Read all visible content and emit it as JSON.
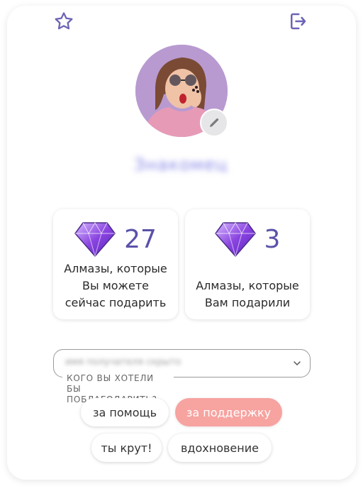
{
  "header": {
    "favorite_icon": "star-icon",
    "logout_icon": "logout-icon"
  },
  "profile": {
    "username": "Знакомец",
    "edit_icon": "pencil-icon"
  },
  "stats": [
    {
      "value": "27",
      "label_lines": [
        "Алмазы, которые",
        "Вы можете",
        "сейчас подарить"
      ],
      "icon": "diamond-icon"
    },
    {
      "value": "3",
      "label_lines": [
        "Алмазы, которые",
        "Вам подарили"
      ],
      "icon": "diamond-icon"
    }
  ],
  "recipient": {
    "label": "КОГО ВЫ ХОТЕЛИ БЫ ПОБЛАГОДАРИТЬ?",
    "value": "имя получателя скрыто",
    "chevron_icon": "chevron-down-icon"
  },
  "reasons": [
    {
      "label": "за помощь",
      "selected": false
    },
    {
      "label": "за поддержку",
      "selected": true
    },
    {
      "label": "ты крут!",
      "selected": false
    },
    {
      "label": "вдохновение",
      "selected": false
    }
  ],
  "colors": {
    "accent": "#5a52a8",
    "chip_active": "#f7a3a0",
    "icon_stroke": "#6b63b5"
  }
}
